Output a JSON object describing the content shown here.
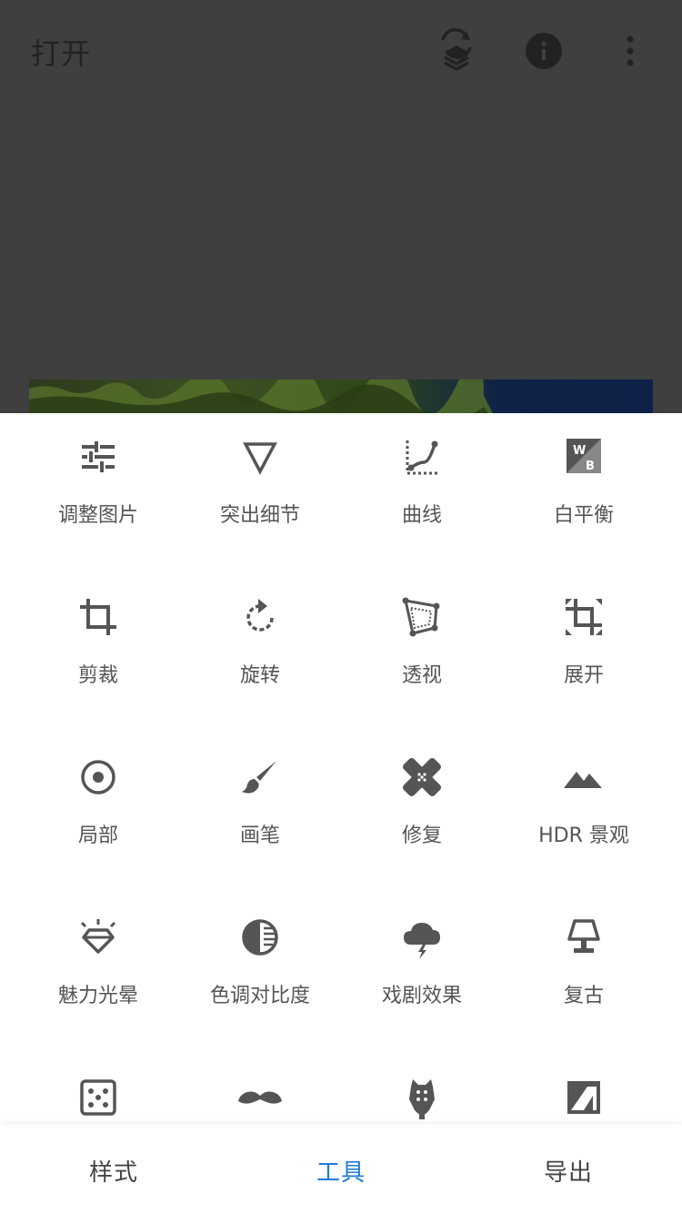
{
  "header": {
    "title": "打开",
    "icons": [
      "history-layers-icon",
      "info-icon",
      "more-vert-icon"
    ]
  },
  "tools": [
    {
      "label": "调整图片",
      "icon": "tune-icon"
    },
    {
      "label": "突出细节",
      "icon": "details-triangle-icon"
    },
    {
      "label": "曲线",
      "icon": "curves-icon"
    },
    {
      "label": "白平衡",
      "icon": "white-balance-icon"
    },
    {
      "label": "剪裁",
      "icon": "crop-icon"
    },
    {
      "label": "旋转",
      "icon": "rotate-icon"
    },
    {
      "label": "透视",
      "icon": "perspective-icon"
    },
    {
      "label": "展开",
      "icon": "expand-icon"
    },
    {
      "label": "局部",
      "icon": "selective-icon"
    },
    {
      "label": "画笔",
      "icon": "brush-icon"
    },
    {
      "label": "修复",
      "icon": "healing-icon"
    },
    {
      "label": "HDR 景观",
      "icon": "hdr-landscape-icon"
    },
    {
      "label": "魅力光晕",
      "icon": "glamour-glow-icon"
    },
    {
      "label": "色调对比度",
      "icon": "tonal-contrast-icon"
    },
    {
      "label": "戏剧效果",
      "icon": "drama-icon"
    },
    {
      "label": "复古",
      "icon": "vintage-lamp-icon"
    },
    {
      "label": "",
      "icon": "grainy-film-icon"
    },
    {
      "label": "",
      "icon": "mustache-icon"
    },
    {
      "label": "",
      "icon": "guitar-icon"
    },
    {
      "label": "",
      "icon": "grunge-icon"
    }
  ],
  "bottom_nav": {
    "styles": "样式",
    "tools": "工具",
    "export": "导出",
    "active": "tools",
    "active_color": "#1e7ad6"
  }
}
